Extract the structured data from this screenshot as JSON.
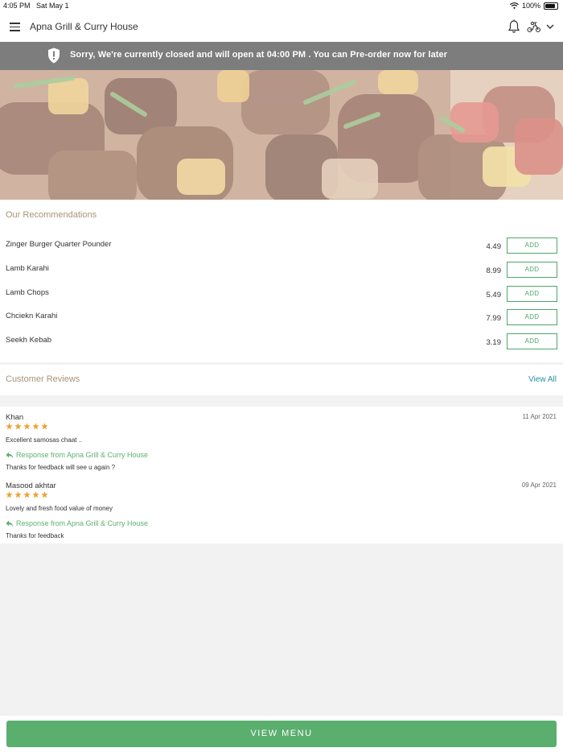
{
  "status_bar": {
    "time": "4:05 PM",
    "date": "Sat May 1",
    "battery": "100%"
  },
  "header": {
    "title": "Apna Grill & Curry House",
    "icons": [
      "menu-icon",
      "bell-icon",
      "scooter-icon",
      "chevron-down-icon"
    ]
  },
  "banner": {
    "message": "Sorry, We're currently closed and will open at 04:00 PM . You can Pre-order now for later",
    "icon": "shield-alert-icon",
    "background": "#7d7d7d"
  },
  "recommendations": {
    "title": "Our Recommendations",
    "items": [
      {
        "name": "Zinger Burger Quarter Pounder",
        "price": "4.49",
        "action": "ADD"
      },
      {
        "name": "Lamb Karahi",
        "price": "8.99",
        "action": "ADD"
      },
      {
        "name": "Lamb Chops",
        "price": "5.49",
        "action": "ADD"
      },
      {
        "name": "Chciekn Karahi",
        "price": "7.99",
        "action": "ADD"
      },
      {
        "name": "Seekh Kebab",
        "price": "3.19",
        "action": "ADD"
      }
    ]
  },
  "reviews": {
    "title": "Customer Reviews",
    "view_all": "View All",
    "items": [
      {
        "reviewer": "Khan",
        "date": "11 Apr 2021",
        "rating": 5,
        "text": "Excellent samosas chaat ..",
        "response_label": "Response from Apna Grill & Curry House",
        "response": "Thanks for feedback will see u again ?"
      },
      {
        "reviewer": "Masood akhtar",
        "date": "09 Apr 2021",
        "rating": 5,
        "text": "Lovely and fresh food value of money",
        "response_label": "Response from Apna Grill & Curry House",
        "response": "Thanks for feedback"
      }
    ]
  },
  "footer": {
    "view_menu": "VIEW MENU"
  },
  "colors": {
    "accent_green": "#5aae6e",
    "section_title": "#a89378",
    "link_blue": "#2a8fa6",
    "star": "#f0a030"
  }
}
